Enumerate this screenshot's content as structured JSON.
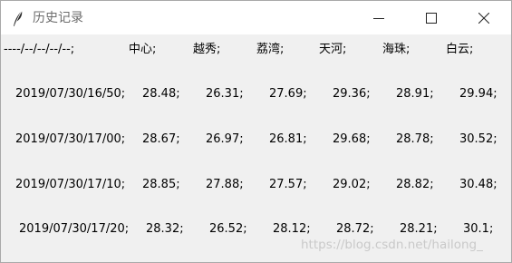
{
  "window": {
    "title": "历史记录",
    "icon": "feather-icon",
    "controls": {
      "minimize": "minimize-icon",
      "maximize": "maximize-icon",
      "close": "close-icon"
    }
  },
  "table": {
    "headers": [
      "----/--/--/--/--;",
      "中心;",
      "越秀;",
      "荔湾;",
      "天河;",
      "海珠;",
      "白云;"
    ],
    "rows": [
      [
        "2019/07/30/16/50;",
        "28.48;",
        "26.31;",
        "27.69;",
        "29.36;",
        "28.91;",
        "29.94;"
      ],
      [
        "2019/07/30/17/00;",
        "28.67;",
        "26.97;",
        "26.81;",
        "29.68;",
        "28.78;",
        "30.52;"
      ],
      [
        "2019/07/30/17/10;",
        "28.85;",
        "27.88;",
        "27.57;",
        "29.02;",
        "28.82;",
        "30.48;"
      ],
      [
        "2019/07/30/17/20;",
        "28.32;",
        "26.52;",
        "28.12;",
        "28.72;",
        "28.21;",
        "30.1;"
      ]
    ]
  },
  "watermark": "https://blog.csdn.net/hailong_",
  "colors": {
    "titlebar": "#ffffff",
    "client": "#f0f0f0",
    "title_text": "#6d6d6d",
    "watermark": "#c9c9c9"
  }
}
